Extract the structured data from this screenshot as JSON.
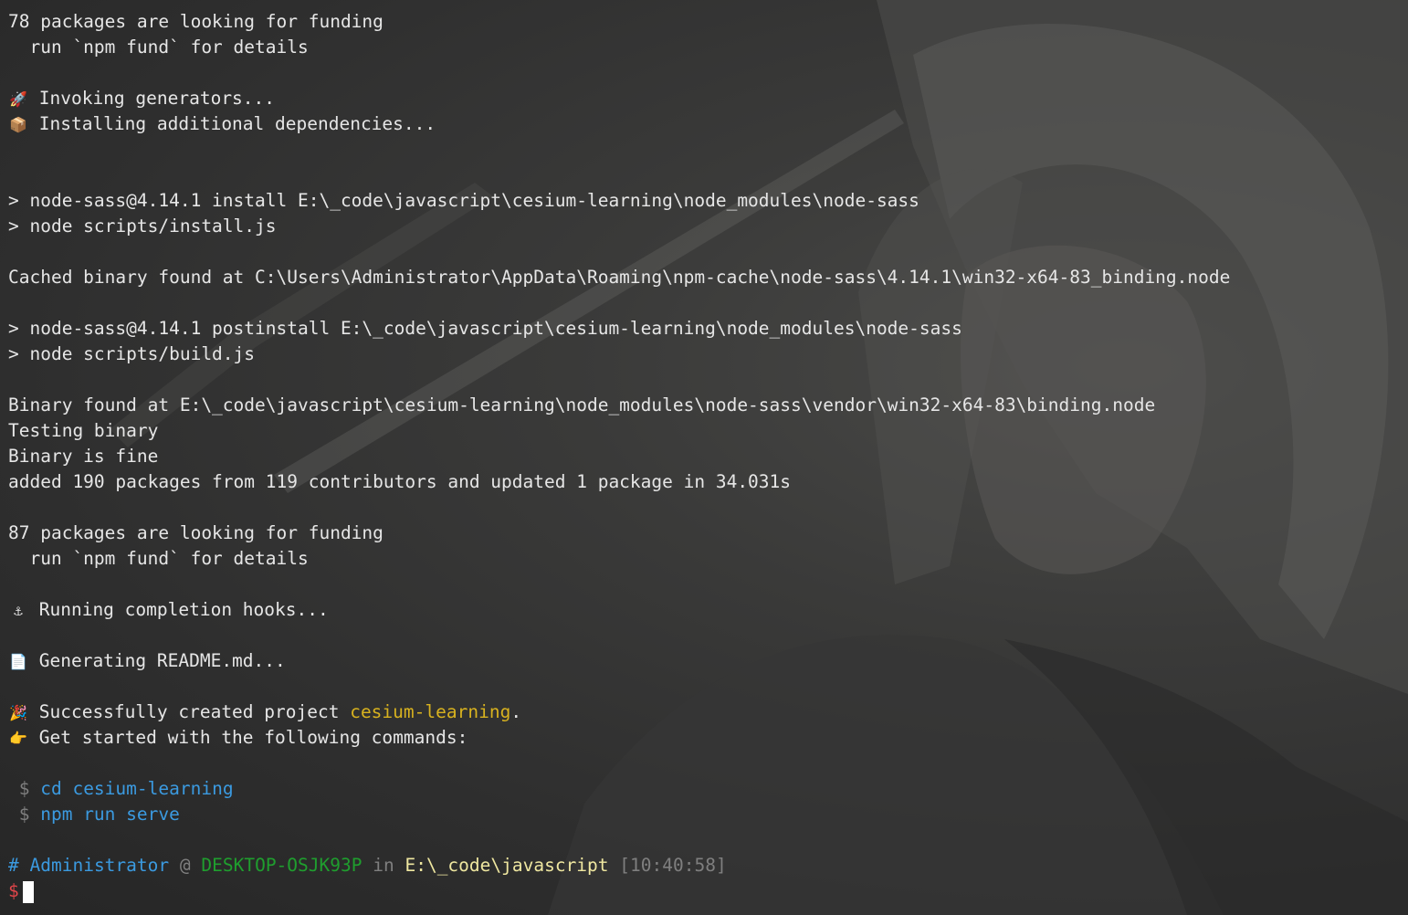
{
  "terminal": {
    "lines": {
      "l01": "78 packages are looking for funding",
      "l02": "  run `npm fund` for details",
      "l04_icon": "🚀",
      "l04_text": " Invoking generators...",
      "l05_icon": "📦",
      "l05_text": " Installing additional dependencies...",
      "l08": "> node-sass@4.14.1 install E:\\_code\\javascript\\cesium-learning\\node_modules\\node-sass",
      "l09": "> node scripts/install.js",
      "l11": "Cached binary found at C:\\Users\\Administrator\\AppData\\Roaming\\npm-cache\\node-sass\\4.14.1\\win32-x64-83_binding.node",
      "l13": "> node-sass@4.14.1 postinstall E:\\_code\\javascript\\cesium-learning\\node_modules\\node-sass",
      "l14": "> node scripts/build.js",
      "l16": "Binary found at E:\\_code\\javascript\\cesium-learning\\node_modules\\node-sass\\vendor\\win32-x64-83\\binding.node",
      "l17": "Testing binary",
      "l18": "Binary is fine",
      "l19": "added 190 packages from 119 contributors and updated 1 package in 34.031s",
      "l21": "87 packages are looking for funding",
      "l22": "  run `npm fund` for details",
      "l24_icon": "⚓",
      "l24_text": " Running completion hooks...",
      "l26_icon": "📄",
      "l26_text": " Generating README.md...",
      "l28_icon": "🎉",
      "l28_text": " Successfully created project ",
      "l28_project": "cesium-learning",
      "l28_end": ".",
      "l29_icon": "👉",
      "l29_text": " Get started with the following commands:",
      "l31_dollar": " $ ",
      "l31_cmd": "cd cesium-learning",
      "l32_dollar": " $ ",
      "l32_cmd": "npm run serve"
    },
    "prompt": {
      "hash": "#",
      "user": "Administrator",
      "at": "@",
      "host": "DESKTOP-OSJK93P",
      "in": "in",
      "cwd": "E:\\_code\\javascript",
      "time": "[10:40:58]",
      "dollar": "$"
    }
  }
}
